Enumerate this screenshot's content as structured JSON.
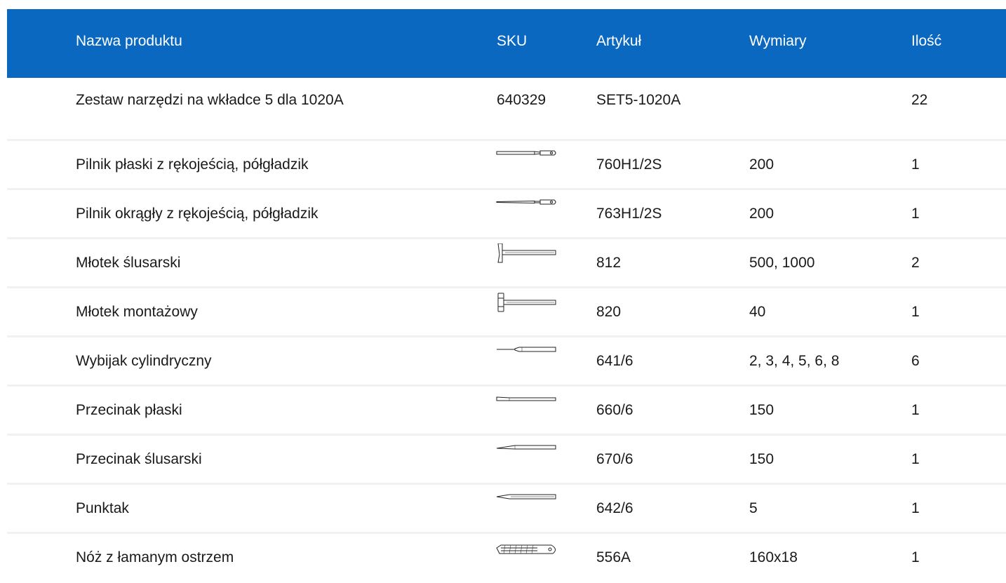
{
  "table": {
    "headers": {
      "name": "Nazwa produktu",
      "sku": "SKU",
      "article": "Artykuł",
      "dimensions": "Wymiary",
      "quantity": "Ilość"
    },
    "set_row": {
      "name": "Zestaw narzędzi na wkładce 5 dla 1020A",
      "sku": "640329",
      "article": "SET5-1020A",
      "dimensions": "",
      "quantity": "22"
    },
    "rows": [
      {
        "name": "Pilnik płaski z rękojeścią, półgładzik",
        "icon": "flat-file-icon",
        "article": "760H1/2S",
        "dimensions": "200",
        "quantity": "1"
      },
      {
        "name": "Pilnik okrągły z rękojeścią, półgładzik",
        "icon": "round-file-icon",
        "article": "763H1/2S",
        "dimensions": "200",
        "quantity": "1"
      },
      {
        "name": "Młotek ślusarski",
        "icon": "locksmith-hammer-icon",
        "article": "812",
        "dimensions": "500, 1000",
        "quantity": "2"
      },
      {
        "name": "Młotek montażowy",
        "icon": "assembly-hammer-icon",
        "article": "820",
        "dimensions": "40",
        "quantity": "1"
      },
      {
        "name": "Wybijak cylindryczny",
        "icon": "pin-punch-icon",
        "article": "641/6",
        "dimensions": "2, 3, 4, 5, 6, 8",
        "quantity": "6"
      },
      {
        "name": "Przecinak płaski",
        "icon": "flat-chisel-icon",
        "article": "660/6",
        "dimensions": "150",
        "quantity": "1"
      },
      {
        "name": "Przecinak ślusarski",
        "icon": "cross-cut-chisel-icon",
        "article": "670/6",
        "dimensions": "150",
        "quantity": "1"
      },
      {
        "name": "Punktak",
        "icon": "center-punch-icon",
        "article": "642/6",
        "dimensions": "5",
        "quantity": "1"
      },
      {
        "name": "Nóż z łamanym ostrzem",
        "icon": "snap-off-knife-icon",
        "article": "556A",
        "dimensions": "160x18",
        "quantity": "1"
      }
    ]
  },
  "colors": {
    "header_bg": "#0a68c0",
    "header_text": "#ffffff",
    "row_divider": "#f1f1f1"
  }
}
